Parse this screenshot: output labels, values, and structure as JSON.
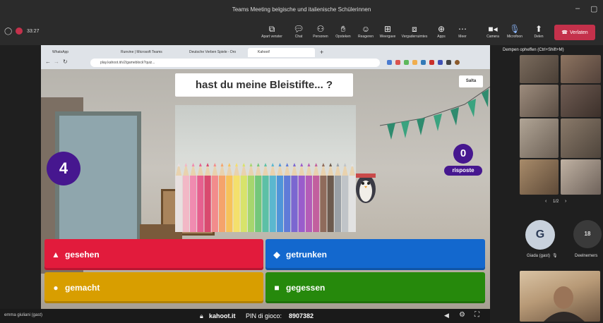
{
  "window": {
    "title": "Teams Meeting belgische und italienische Schülerinnen"
  },
  "toolbar": {
    "timer": "33:27",
    "items": [
      {
        "icon": "share-screen-icon",
        "label": "Apart venster"
      },
      {
        "icon": "chat-icon",
        "label": "Chat"
      },
      {
        "icon": "people-icon",
        "label": "Personen"
      },
      {
        "icon": "raise-hand-icon",
        "label": "Opsteken"
      },
      {
        "icon": "reactions-icon",
        "label": "Reageren"
      },
      {
        "icon": "layout-icon",
        "label": "Weergave"
      },
      {
        "icon": "rooms-icon",
        "label": "Vergaderruimtes"
      },
      {
        "icon": "apps-icon",
        "label": "Apps"
      },
      {
        "icon": "more-icon",
        "label": "Meer"
      },
      {
        "icon": "camera-icon",
        "label": "Camera"
      },
      {
        "icon": "microphone-icon",
        "label": "Microfoon"
      },
      {
        "icon": "share-icon",
        "label": "Delen"
      }
    ],
    "leave_label": "Verlaten"
  },
  "browser": {
    "tabs": [
      {
        "label": "WhatsApp"
      },
      {
        "label": "Runvine | Microsoft Teams"
      },
      {
        "label": "Deutsche Verben Spiele - Dro"
      },
      {
        "label": "Kahoot!"
      }
    ],
    "url": "play.kahoot.it/v2/gameblock?quiz..."
  },
  "game": {
    "question": "hast du meine Bleistifte... ?",
    "skip_label": "Salta",
    "timer_value": "4",
    "answers_count": "0",
    "answers_label": "risposte",
    "answers": [
      {
        "symbol": "▲",
        "text": "gesehen",
        "color": "#e21b3c"
      },
      {
        "symbol": "◆",
        "text": "getrunken",
        "color": "#1368ce"
      },
      {
        "symbol": "●",
        "text": "gemacht",
        "color": "#d89e00"
      },
      {
        "symbol": "■",
        "text": "gegessen",
        "color": "#26890c"
      }
    ],
    "pencil_colors": [
      "#e8e0e0",
      "#f2b8c6",
      "#f08bb0",
      "#e6608f",
      "#d94a6f",
      "#f28c8c",
      "#f5a36b",
      "#f7c25a",
      "#f4e06c",
      "#d8e36b",
      "#a6d66e",
      "#74c77a",
      "#5cc0a6",
      "#5bb7cf",
      "#4f95d9",
      "#5f7bd8",
      "#7b67d0",
      "#9a5ccc",
      "#b45cb8",
      "#c25f9e",
      "#8f6b5b",
      "#6c5a4e",
      "#9aa0a6",
      "#c0c4c8",
      "#e2e2e2"
    ]
  },
  "status": {
    "presenter": "emma giuliani (gast)",
    "url_text": "kahoot.it",
    "pin_label": "PIN di gioco:",
    "pin_value": "8907382"
  },
  "sidebar": {
    "hint": "Dempen opheffen (Ctrl+Shift+M)",
    "pager": "1/2",
    "avatar_initial": "G",
    "avatar_name": "Giada (gast)",
    "others_count": "18",
    "others_label": "Deelnemers"
  }
}
